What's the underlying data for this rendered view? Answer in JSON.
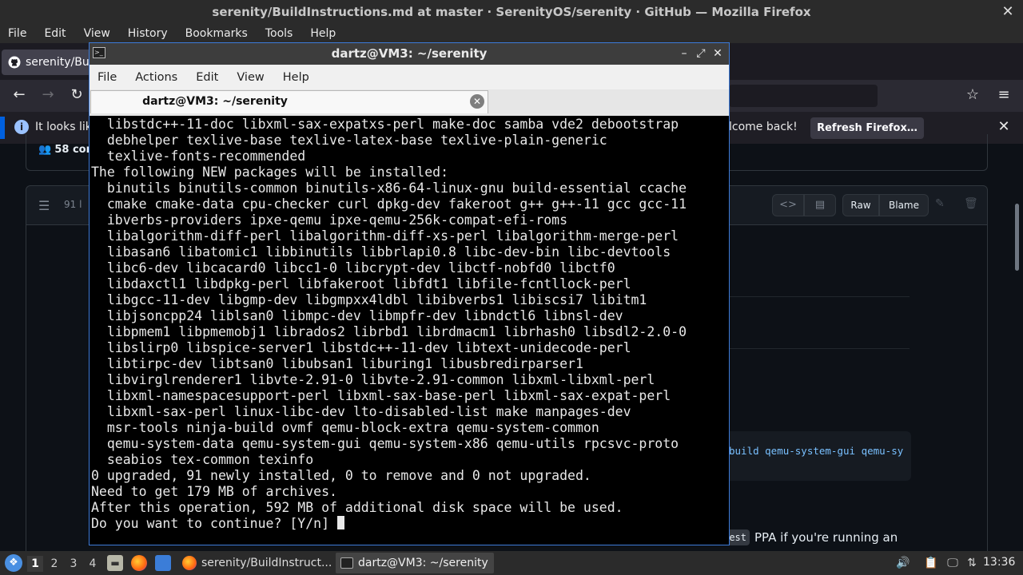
{
  "firefox": {
    "window_title": "serenity/BuildInstructions.md at master · SerenityOS/serenity · GitHub — Mozilla Firefox",
    "close_glyph": "✕",
    "menu": [
      "File",
      "Edit",
      "View",
      "History",
      "Bookmarks",
      "Tools",
      "Help"
    ],
    "tab_title": "serenity/Buil",
    "nav": {
      "back": "←",
      "forward": "→",
      "reload": "↻",
      "bookmark": "☆",
      "menu": "≡"
    },
    "notification": {
      "info_glyph": "i",
      "text": "It looks lik",
      "welcome_text": "lcome back!",
      "button": "Refresh Firefox…",
      "close_glyph": "✕"
    }
  },
  "github": {
    "contributors": "58 con",
    "lines": "91 l",
    "raw": "Raw",
    "blame": "Blame",
    "code_snippet": "build qemu-system-gui qemu-sy",
    "ppa_code": "est",
    "ppa_text": "PPA if you're running an"
  },
  "terminal": {
    "window_title": "dartz@VM3: ~/serenity",
    "menu": [
      "File",
      "Actions",
      "Edit",
      "View",
      "Help"
    ],
    "tab_label": "dartz@VM3: ~/serenity",
    "tab_close": "✕",
    "output_lines": [
      "  libstdc++-11-doc libxml-sax-expatxs-perl make-doc samba vde2 debootstrap",
      "  debhelper texlive-base texlive-latex-base texlive-plain-generic",
      "  texlive-fonts-recommended",
      "The following NEW packages will be installed:",
      "  binutils binutils-common binutils-x86-64-linux-gnu build-essential ccache",
      "  cmake cmake-data cpu-checker curl dpkg-dev fakeroot g++ g++-11 gcc gcc-11",
      "  ibverbs-providers ipxe-qemu ipxe-qemu-256k-compat-efi-roms",
      "  libalgorithm-diff-perl libalgorithm-diff-xs-perl libalgorithm-merge-perl",
      "  libasan6 libatomic1 libbinutils libbrlapi0.8 libc-dev-bin libc-devtools",
      "  libc6-dev libcacard0 libcc1-0 libcrypt-dev libctf-nobfd0 libctf0",
      "  libdaxctl1 libdpkg-perl libfakeroot libfdt1 libfile-fcntllock-perl",
      "  libgcc-11-dev libgmp-dev libgmpxx4ldbl libibverbs1 libiscsi7 libitm1",
      "  libjsoncpp24 liblsan0 libmpc-dev libmpfr-dev libndctl6 libnsl-dev",
      "  libpmem1 libpmemobj1 librados2 librbd1 librdmacm1 librhash0 libsdl2-2.0-0",
      "  libslirp0 libspice-server1 libstdc++-11-dev libtext-unidecode-perl",
      "  libtirpc-dev libtsan0 libubsan1 liburing1 libusbredirparser1",
      "  libvirglrenderer1 libvte-2.91-0 libvte-2.91-common libxml-libxml-perl",
      "  libxml-namespacesupport-perl libxml-sax-base-perl libxml-sax-expat-perl",
      "  libxml-sax-perl linux-libc-dev lto-disabled-list make manpages-dev",
      "  msr-tools ninja-build ovmf qemu-block-extra qemu-system-common",
      "  qemu-system-data qemu-system-gui qemu-system-x86 qemu-utils rpcsvc-proto",
      "  seabios tex-common texinfo",
      "0 upgraded, 91 newly installed, 0 to remove and 0 not upgraded.",
      "Need to get 179 MB of archives.",
      "After this operation, 592 MB of additional disk space will be used.",
      "Do you want to continue? [Y/n] "
    ]
  },
  "taskbar": {
    "workspaces": [
      "1",
      "2",
      "3",
      "4"
    ],
    "firefox_item": "serenity/BuildInstruct...",
    "terminal_item": "dartz@VM3: ~/serenity",
    "clock": "13:36"
  },
  "colors": {
    "terminal_border": "#3d7bd9",
    "firefox_accent": "#0060df",
    "github_bg": "#0d1117"
  }
}
